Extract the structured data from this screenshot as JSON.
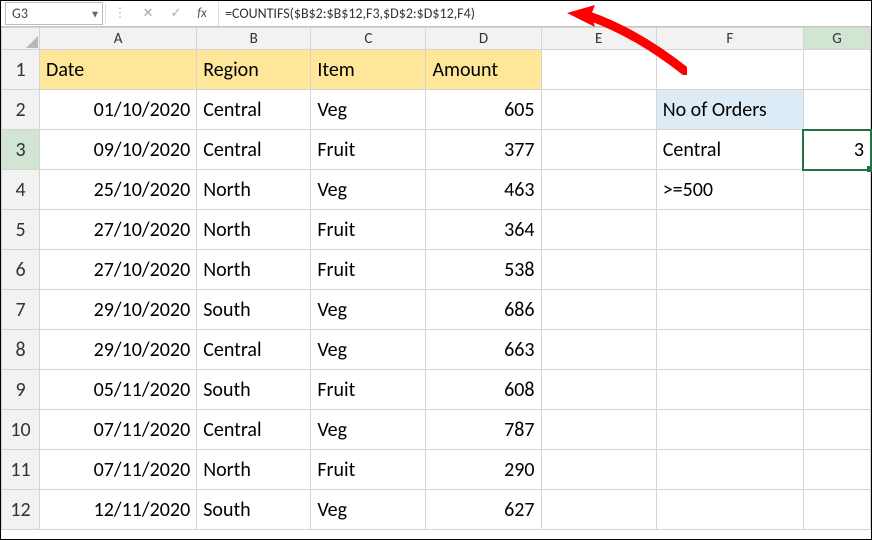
{
  "formula_bar": {
    "cell_ref": "G3",
    "fx_label": "fx",
    "formula": "=COUNTIFS($B$2:$B$12,F3,$D$2:$D$12,F4)"
  },
  "columns": [
    "A",
    "B",
    "C",
    "D",
    "E",
    "F",
    "G"
  ],
  "headers": {
    "A": "Date",
    "B": "Region",
    "C": "Item",
    "D": "Amount"
  },
  "rows": [
    {
      "n": 1
    },
    {
      "n": 2,
      "A": "01/10/2020",
      "B": "Central",
      "C": "Veg",
      "D": "605",
      "F": "No of Orders",
      "F_class": "sub-hdr"
    },
    {
      "n": 3,
      "A": "09/10/2020",
      "B": "Central",
      "C": "Fruit",
      "D": "377",
      "F": "Central",
      "G": "3",
      "sel": true
    },
    {
      "n": 4,
      "A": "25/10/2020",
      "B": "North",
      "C": "Veg",
      "D": "463",
      "F": ">=500"
    },
    {
      "n": 5,
      "A": "27/10/2020",
      "B": "North",
      "C": "Fruit",
      "D": "364"
    },
    {
      "n": 6,
      "A": "27/10/2020",
      "B": "North",
      "C": "Fruit",
      "D": "538"
    },
    {
      "n": 7,
      "A": "29/10/2020",
      "B": "South",
      "C": "Veg",
      "D": "686"
    },
    {
      "n": 8,
      "A": "29/10/2020",
      "B": "Central",
      "C": "Veg",
      "D": "663"
    },
    {
      "n": 9,
      "A": "05/11/2020",
      "B": "South",
      "C": "Fruit",
      "D": "608"
    },
    {
      "n": 10,
      "A": "07/11/2020",
      "B": "Central",
      "C": "Veg",
      "D": "787"
    },
    {
      "n": 11,
      "A": "07/11/2020",
      "B": "North",
      "C": "Fruit",
      "D": "290"
    },
    {
      "n": 12,
      "A": "12/11/2020",
      "B": "South",
      "C": "Veg",
      "D": "627"
    }
  ],
  "col_widths": {
    "rowhdr": 38,
    "A": 157,
    "B": 114,
    "C": 115,
    "D": 115,
    "E": 115,
    "F": 147,
    "G": 67
  }
}
